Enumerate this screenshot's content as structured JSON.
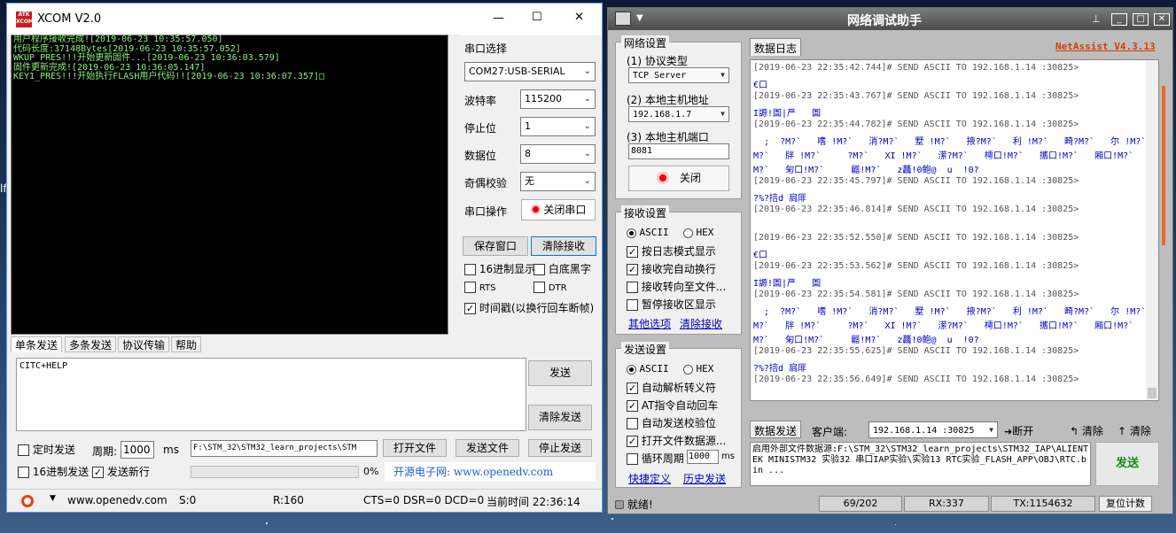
{
  "xcom": {
    "title": "XCOM V2.0",
    "logo_text": "ATK\nXCOM",
    "window_controls": {
      "min": "—",
      "max": "☐",
      "close": "✕"
    },
    "terminal_lines": [
      "用户程序接收完成![2019-06-23 10:35:57.050]",
      "代码长度:37148Bytes[2019-06-23 10:35:57.052]",
      "WKUP_PRES!!!开始更新固件...[2019-06-23 10:36:03.579]",
      "固件更新完成![2019-06-23 10:36:05.147]",
      "KEY1_PRES!!!开始执行FLASH用户代码!![2019-06-23 10:36:07.357]□"
    ],
    "port_label": "串口选择",
    "port_value": "COM27:USB-SERIAL",
    "baud_label": "波特率",
    "baud_value": "115200",
    "stop_label": "停止位",
    "stop_value": "1",
    "data_label": "数据位",
    "data_value": "8",
    "parity_label": "奇偶校验",
    "parity_value": "无",
    "op_label": "串口操作",
    "close_port": "关闭串口",
    "save_window": "保存窗口",
    "clear_recv": "清除接收",
    "hex_display": "16进制显示",
    "white_black": "白底黑字",
    "rts": "RTS",
    "dtr": "DTR",
    "timestamp": "时间戳(以换行回车断帧)",
    "tabs": [
      "单条发送",
      "多条发送",
      "协议传输",
      "帮助"
    ],
    "send_text": "CITC+HELP",
    "send_btn": "发送",
    "clear_send": "清除发送",
    "timed_send": "定时发送",
    "period_label": "周期:",
    "period_value": "1000",
    "ms": "ms",
    "file_path": "F:\\STM_32\\STM32_learn_projects\\STM",
    "open_file": "打开文件",
    "send_file": "发送文件",
    "stop_send": "停止发送",
    "hex_send": "16进制发送",
    "send_newline": "发送新行",
    "progress": "0%",
    "progress_value": 0,
    "promo": "开源电子网: www.openedv.com",
    "status_site": "www.openedv.com",
    "status_s": "S:0",
    "status_r": "R:160",
    "status_lines": "CTS=0 DSR=0 DCD=0",
    "status_time": "当前时间 22:36:14"
  },
  "netassist": {
    "title": "网络调试助手",
    "brand": "NetAssist V4.3.13",
    "net_group": "网络设置",
    "protocol_label": "(1) 协议类型",
    "protocol_value": "TCP Server",
    "host_label": "(2) 本地主机地址",
    "host_value": "192.168.1.7",
    "port_label": "(3) 本地主机端口",
    "port_value": "8081",
    "close_btn": "关闭",
    "recv_group": "接收设置",
    "ascii": "ASCII",
    "hex": "HEX",
    "recv_opts": [
      "按日志模式显示",
      "接收完自动换行",
      "接收转向至文件...",
      "暂停接收区显示"
    ],
    "more_opts": "其他选项",
    "clear_recv": "清除接收",
    "send_group": "发送设置",
    "send_opts": [
      "自动解析转义符",
      "AT指令自动回车",
      "自动发送校验位",
      "打开文件数据源...",
      "循环周期"
    ],
    "cycle_value": "1000",
    "ms": "ms",
    "shortcut": "快捷定义",
    "history": "历史发送",
    "log_tab": "数据日志",
    "log": [
      {
        "t": "[2019-06-23 22:35:42.744]# SEND ASCII TO 192.168.1.14 :30825>",
        "r": "€口"
      },
      {
        "t": "[2019-06-23 22:35:43.767]# SEND ASCII TO 192.168.1.14 :30825>",
        "r": "I謜!圄|严   圄"
      },
      {
        "t": "[2019-06-23 22:35:44.782]# SEND ASCII TO 192.168.1.14 :30825>",
        "r": "  ;  ?M?`   嗜 !M?`   消?M?`   墅 !M?`   掖?M?`   利 !M?`   畸?M?`   尔 !M?`   丙?",
        "r2": "M?`   牉 !M?`     ?M?`   XI !M?`   潆?M?`   樗口!M?`   攜口!M?`   厢口!M?`   岙3!",
        "r3": "M?`   匊口!M?`     龤!M?`   z龘!0鲍@  u  !0?"
      },
      {
        "t": "[2019-06-23 22:35:45.797]# SEND ASCII TO 192.168.1.14 :30825>",
        "r": "?%?掊d 扃厞"
      },
      {
        "t": "[2019-06-23 22:35:46.814]# SEND ASCII TO 192.168.1.14 :30825>",
        "r": ""
      },
      {
        "t": "[2019-06-23 22:35:52.550]# SEND ASCII TO 192.168.1.14 :30825>",
        "r": "€口"
      },
      {
        "t": "[2019-06-23 22:35:53.562]# SEND ASCII TO 192.168.1.14 :30825>",
        "r": "I謜!圄|严   圄"
      },
      {
        "t": "[2019-06-23 22:35:54.581]# SEND ASCII TO 192.168.1.14 :30825>",
        "r": "  ;  ?M?`   嗜 !M?`   消?M?`   墅 !M?`   掖?M?`   利 !M?`   畸?M?`   尔 !M?`   丙?",
        "r2": "M?`   牉 !M?`     ?M?`   XI !M?`   潆?M?`   樗口!M?`   攜口!M?`   厢口!M?`   岙3!",
        "r3": "M?`   匊口!M?`     龤!M?`   z龘!0鲍@  u  !0?"
      },
      {
        "t": "[2019-06-23 22:35:55.625]# SEND ASCII TO 192.168.1.14 :30825>",
        "r": "?%?掊d 扃厞"
      },
      {
        "t": "[2019-06-23 22:35:56.649]# SEND ASCII TO 192.168.1.14 :30825>",
        "r": ""
      }
    ],
    "send_tab": "数据发送",
    "client_label": "客户端:",
    "client_value": "192.168.1.14 :30825",
    "disconnect": "断开",
    "clear1": "清除",
    "clear2": "清除",
    "send_text": "启用外部文件数据源:F:\\STM_32\\STM32_learn_projects\\STM32_IAP\\ALIENTEK MINISTM32 实验32 串口IAP实验\\实验13 RTC实验_FLASH_APP\\OBJ\\RTC.bin ...",
    "send_btn": "发送",
    "status": "就绪!",
    "count": "69/202",
    "rx": "RX:337",
    "tx": "TX:1154632",
    "reset": "复位计数"
  },
  "desktop_side": {
    "label": "lf"
  }
}
